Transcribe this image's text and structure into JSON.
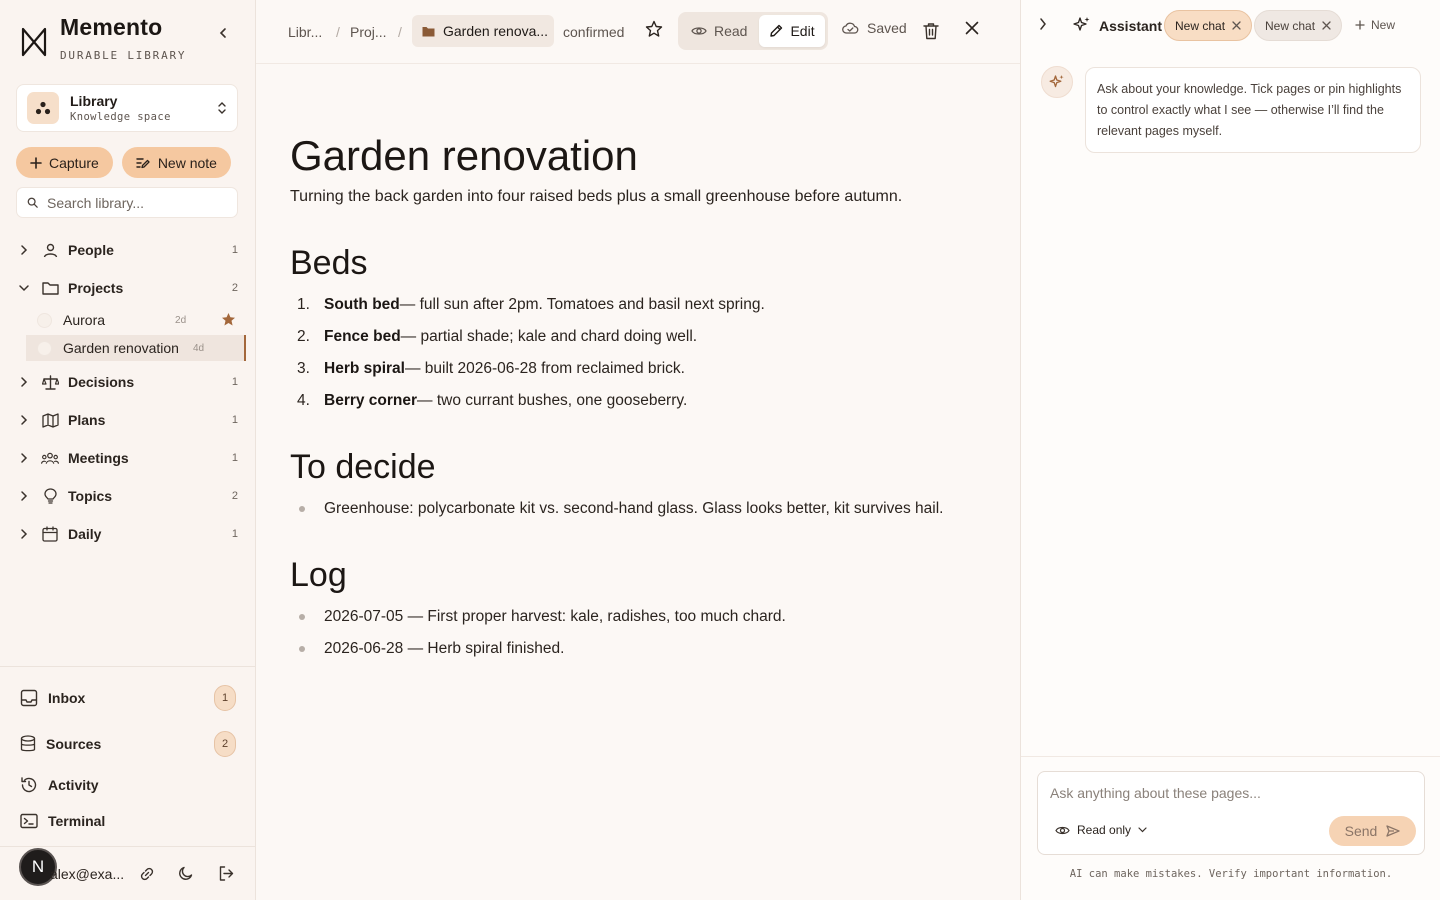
{
  "app": {
    "name": "Memento",
    "subtitle": "DURABLE LIBRARY"
  },
  "workspace": {
    "name": "Library",
    "subtitle": "Knowledge space"
  },
  "actions": {
    "capture_label": "Capture",
    "new_note_label": "New note"
  },
  "search": {
    "placeholder": "Search library..."
  },
  "tree": [
    {
      "label": "People",
      "count": "1",
      "icon": "person-icon",
      "expanded": false
    },
    {
      "label": "Projects",
      "count": "2",
      "icon": "folder-icon",
      "expanded": true,
      "children": [
        {
          "label": "Aurora",
          "age": "2d",
          "starred": true
        },
        {
          "label": "Garden renovation",
          "age": "4d",
          "active": true
        }
      ]
    },
    {
      "label": "Decisions",
      "count": "1",
      "icon": "scale-icon",
      "expanded": false
    },
    {
      "label": "Plans",
      "count": "1",
      "icon": "map-icon",
      "expanded": false
    },
    {
      "label": "Meetings",
      "count": "1",
      "icon": "group-icon",
      "expanded": false
    },
    {
      "label": "Topics",
      "count": "2",
      "icon": "lightbulb-icon",
      "expanded": false
    },
    {
      "label": "Daily",
      "count": "1",
      "icon": "calendar-icon",
      "expanded": false
    }
  ],
  "bottom_nav": [
    {
      "label": "Inbox",
      "badge": "1",
      "icon": "inbox-icon"
    },
    {
      "label": "Sources",
      "badge": "2",
      "icon": "database-icon"
    },
    {
      "label": "Activity",
      "icon": "history-icon"
    },
    {
      "label": "Terminal",
      "icon": "terminal-icon"
    }
  ],
  "user": {
    "avatar_letter": "N",
    "email": "alex@exa..."
  },
  "topbar": {
    "crumbs": [
      "Libr...",
      "Proj..."
    ],
    "current": "Garden renova...",
    "status": "confirmed",
    "read_label": "Read",
    "edit_label": "Edit",
    "mode": "edit",
    "saved_label": "Saved"
  },
  "document": {
    "title": "Garden renovation",
    "summary": "Turning the back garden into four raised beds plus a small greenhouse before autumn.",
    "sections": [
      {
        "heading": "Beds",
        "ordered": true,
        "items": [
          {
            "bold": "South bed",
            "text": " — full sun after 2pm. Tomatoes and basil next spring."
          },
          {
            "bold": "Fence bed",
            "text": " — partial shade; kale and chard doing well."
          },
          {
            "bold": "Herb spiral",
            "text": " — built 2026-06-28 from reclaimed brick."
          },
          {
            "bold": "Berry corner",
            "text": " — two currant bushes, one gooseberry."
          }
        ]
      },
      {
        "heading": "To decide",
        "ordered": false,
        "items": [
          {
            "text": "Greenhouse: polycarbonate kit vs. second-hand glass. Glass looks better, kit survives hail."
          }
        ]
      },
      {
        "heading": "Log",
        "ordered": false,
        "items": [
          {
            "text": "2026-07-05 — First proper harvest: kale, radishes, too much chard."
          },
          {
            "text": "2026-06-28 — Herb spiral finished."
          }
        ]
      }
    ]
  },
  "assistant": {
    "title": "Assistant",
    "tabs": [
      {
        "label": "New chat",
        "active": true
      },
      {
        "label": "New chat",
        "active": false
      }
    ],
    "new_label": "New",
    "intro_message": "Ask about your knowledge. Tick pages or pin highlights to control exactly what I see — otherwise I’ll find the relevant pages myself.",
    "input_placeholder": "Ask anything about these pages...",
    "mode_label": "Read only",
    "send_label": "Send",
    "disclaimer": "AI can make mistakes. Verify important information."
  },
  "colors": {
    "accent": "#f5c8a0",
    "accent_dark": "#a3673b",
    "background": "#fcf8f5",
    "sidebar": "#faf4f0"
  }
}
